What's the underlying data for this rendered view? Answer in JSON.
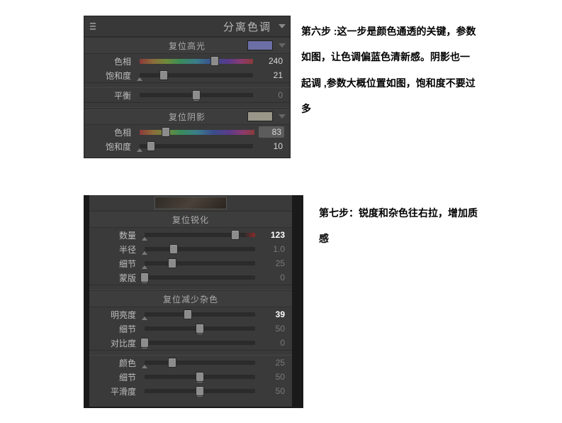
{
  "panel1": {
    "title": "分离色调",
    "highlights": {
      "title": "复位高光",
      "swatch": "#6c6fa6",
      "hue": {
        "label": "色相",
        "value": "240",
        "pos": 66
      },
      "sat": {
        "label": "饱和度",
        "value": "21",
        "pos": 21
      }
    },
    "balance": {
      "label": "平衡",
      "value": "0",
      "pos": 50
    },
    "shadows": {
      "title": "复位阴影",
      "swatch": "#9a9688",
      "hue": {
        "label": "色相",
        "value": "83",
        "pos": 23
      },
      "sat": {
        "label": "饱和度",
        "value": "10",
        "pos": 10
      }
    }
  },
  "panel2": {
    "sharpen": {
      "title": "复位锐化",
      "amount": {
        "label": "数量",
        "value": "123",
        "pos": 82
      },
      "radius": {
        "label": "半径",
        "value": "1.0",
        "pos": 26
      },
      "detail": {
        "label": "细节",
        "value": "25",
        "pos": 25
      },
      "mask": {
        "label": "蒙版",
        "value": "0",
        "pos": 0
      }
    },
    "noise": {
      "title": "复位减少杂色",
      "lum": {
        "label": "明亮度",
        "value": "39",
        "pos": 39
      },
      "ldetail": {
        "label": "细节",
        "value": "50",
        "pos": 50
      },
      "lcontrast": {
        "label": "对比度",
        "value": "0",
        "pos": 0
      },
      "color": {
        "label": "颜色",
        "value": "25",
        "pos": 25
      },
      "cdetail": {
        "label": "细节",
        "value": "50",
        "pos": 50
      },
      "csmooth": {
        "label": "平滑度",
        "value": "50",
        "pos": 50
      }
    }
  },
  "notes": {
    "step6": "第六步 :这一步是颜色通透的关键，参数如图，让色调偏蓝色清新感。阴影也一起调 ,参数大概位置如图，饱和度不要过多",
    "step7": "第七步：锐度和杂色往右拉，增加质感"
  }
}
